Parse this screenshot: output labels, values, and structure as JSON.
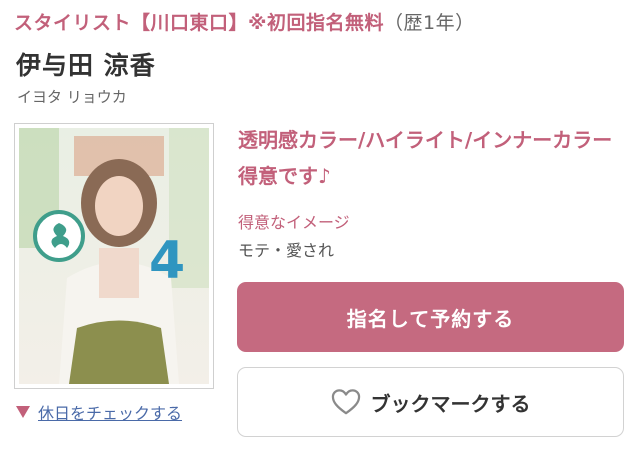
{
  "header": {
    "role": "スタイリスト",
    "salon": "【川口東口】",
    "promo": "※初回指名無料",
    "years": "（歴1年）"
  },
  "stylist": {
    "name": "伊与田 涼香",
    "kana": "イヨタ リョウカ"
  },
  "photo": {
    "alt": "stylist photo"
  },
  "catch_copy": "透明感カラー/ハイライト/インナーカラー 得意です♪",
  "image": {
    "label": "得意なイメージ",
    "value": "モテ・愛され"
  },
  "actions": {
    "reserve_label": "指名して予約する",
    "bookmark_label": "ブックマークする",
    "holiday_label": "休日をチェックする"
  },
  "colors": {
    "accent": "#c2607a",
    "reserve_button": "#c56a80",
    "link": "#4a6aa8"
  },
  "icons": {
    "bookmark": "heart-icon",
    "holiday": "triangle-down-icon"
  }
}
